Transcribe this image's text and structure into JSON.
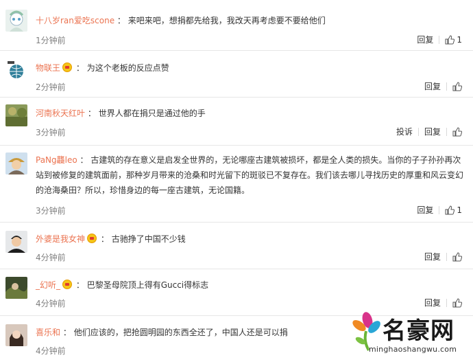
{
  "comments": [
    {
      "username": "十八岁ran爱吃scone",
      "text": "来吧来吧，想捐都先给我，我改天再考虑要不要给他们",
      "time": "1分钟前",
      "reply_label": "回复",
      "like_count": "1",
      "has_badge": false
    },
    {
      "username": "物联王",
      "text": "为这个老板的反应点赞",
      "time": "2分钟前",
      "reply_label": "回复",
      "has_badge": true
    },
    {
      "username": "河南秋天红叶",
      "text": "世界人都在捐只是通过他的手",
      "time": "3分钟前",
      "report_label": "投诉",
      "reply_label": "回复",
      "has_badge": false
    },
    {
      "username": "PaNg龘leo",
      "text": "古建筑的存在意义是启发全世界的，无论哪座古建筑被损坏，都是全人类的损失。当你的子子孙孙再次站到被修复的建筑面前，那种岁月带来的沧桑和时光留下的斑驳已不复存在。我们该去哪儿寻找历史的厚重和风云变幻的沧海桑田？所以，珍惜身边的每一座古建筑，无论国籍。",
      "time": "3分钟前",
      "reply_label": "回复",
      "like_count": "1",
      "has_badge": false
    },
    {
      "username": "外婆是我女神",
      "text": "古驰挣了中国不少钱",
      "time": "4分钟前",
      "reply_label": "回复",
      "has_badge": true
    },
    {
      "username": "_幻听_",
      "text": "巴黎圣母院顶上得有Gucci得标志",
      "time": "4分钟前",
      "reply_label": "回复",
      "has_badge": true
    },
    {
      "username": "喜乐和",
      "text": "他们应该的，把抢圆明园的东西全还了，中国人还是可以捐",
      "time": "4分钟前",
      "has_badge": false
    }
  ],
  "separator": "：",
  "watermark": {
    "title": "名豪网",
    "url": "minghaoshangwu.com"
  },
  "colors": {
    "username": "#eb7350",
    "time": "#808080",
    "text": "#333333",
    "border": "#e6e6e6"
  }
}
